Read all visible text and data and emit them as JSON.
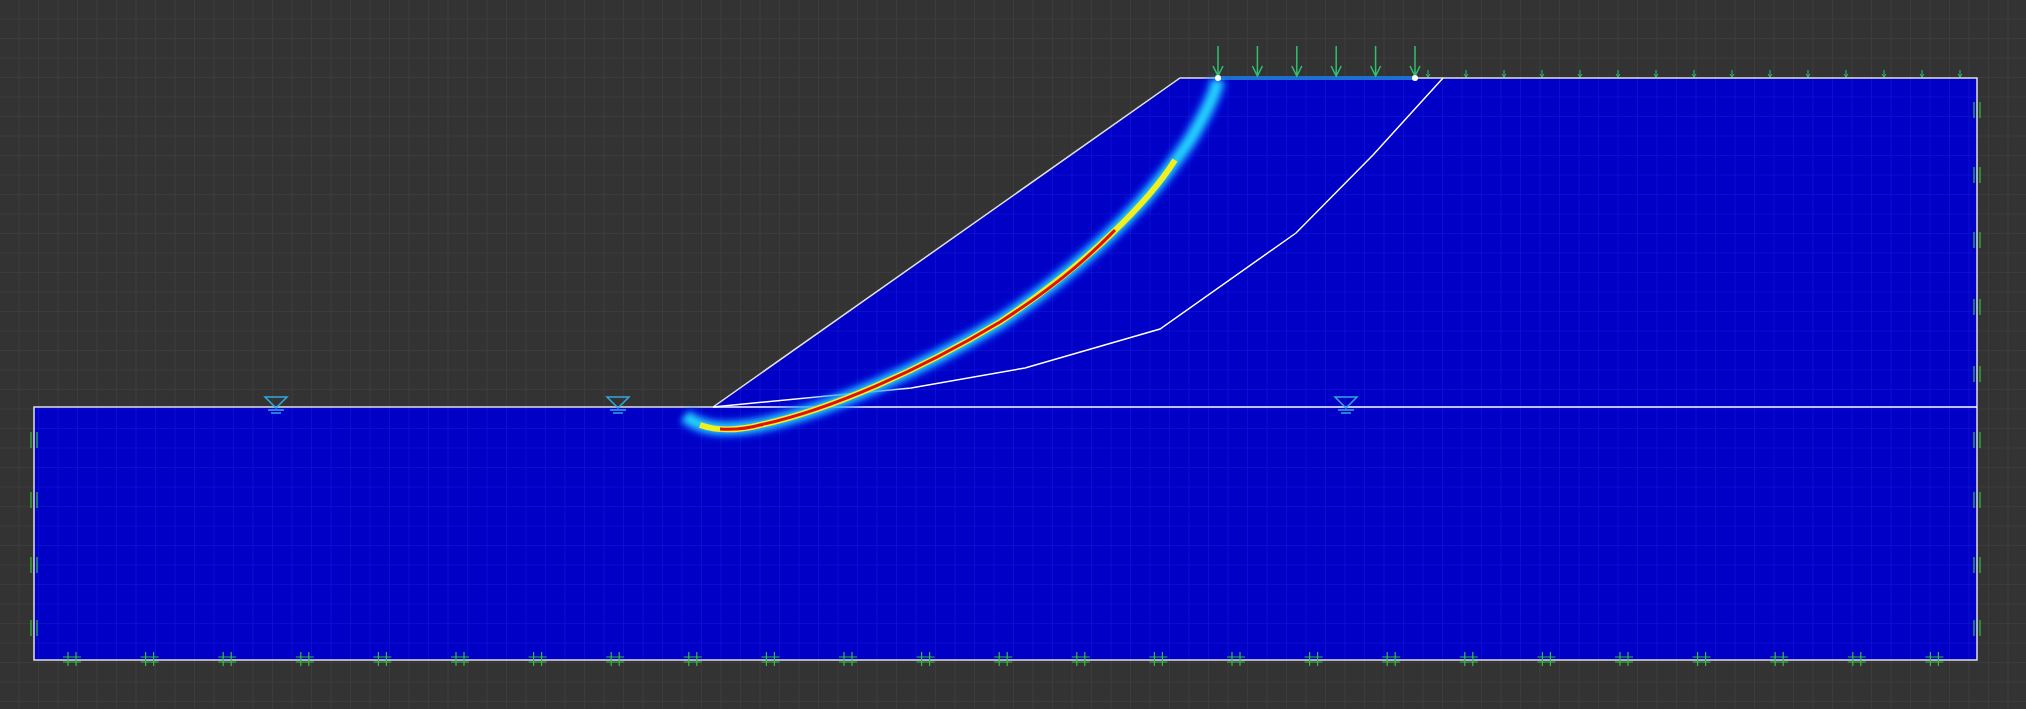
{
  "canvas": {
    "kind": "slope-model",
    "grid": true
  }
}
